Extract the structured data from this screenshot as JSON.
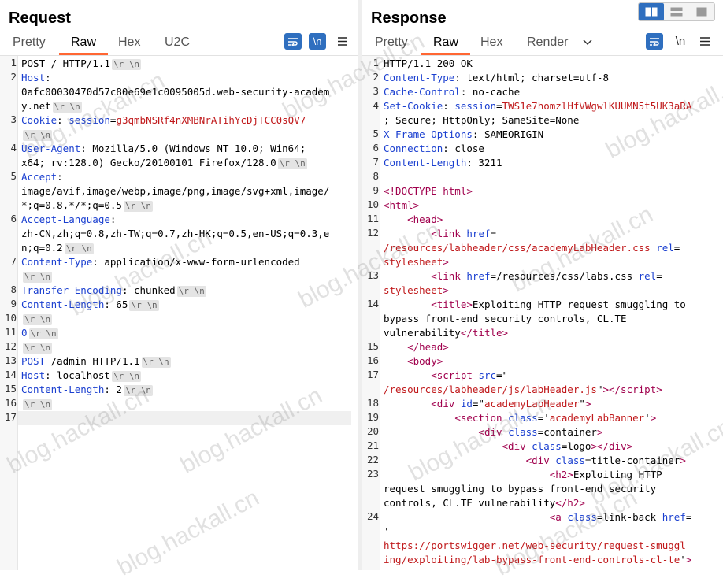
{
  "request": {
    "title": "Request",
    "tabs": [
      "Pretty",
      "Raw",
      "Hex",
      "U2C"
    ],
    "active_tab": "Raw",
    "wrap_icon": "wrap-lines-icon",
    "newline_label": "\\n",
    "menu_icon": "hamburger-menu-icon",
    "crlf_label": "\\r \\n"
  },
  "response": {
    "title": "Response",
    "tabs": [
      "Pretty",
      "Raw",
      "Hex",
      "Render"
    ],
    "active_tab": "Raw",
    "dropdown_icon": "chevron-down-icon",
    "newline_label": "\\n",
    "menu_icon": "hamburger-menu-icon"
  },
  "watermark": "blog.hackall.cn",
  "colors": {
    "accent": "#2f6fbf",
    "tab_underline": "#ff6633",
    "header_name": "#1a3fd0",
    "header_value": "#c0191b",
    "tag": "#a0004d"
  }
}
